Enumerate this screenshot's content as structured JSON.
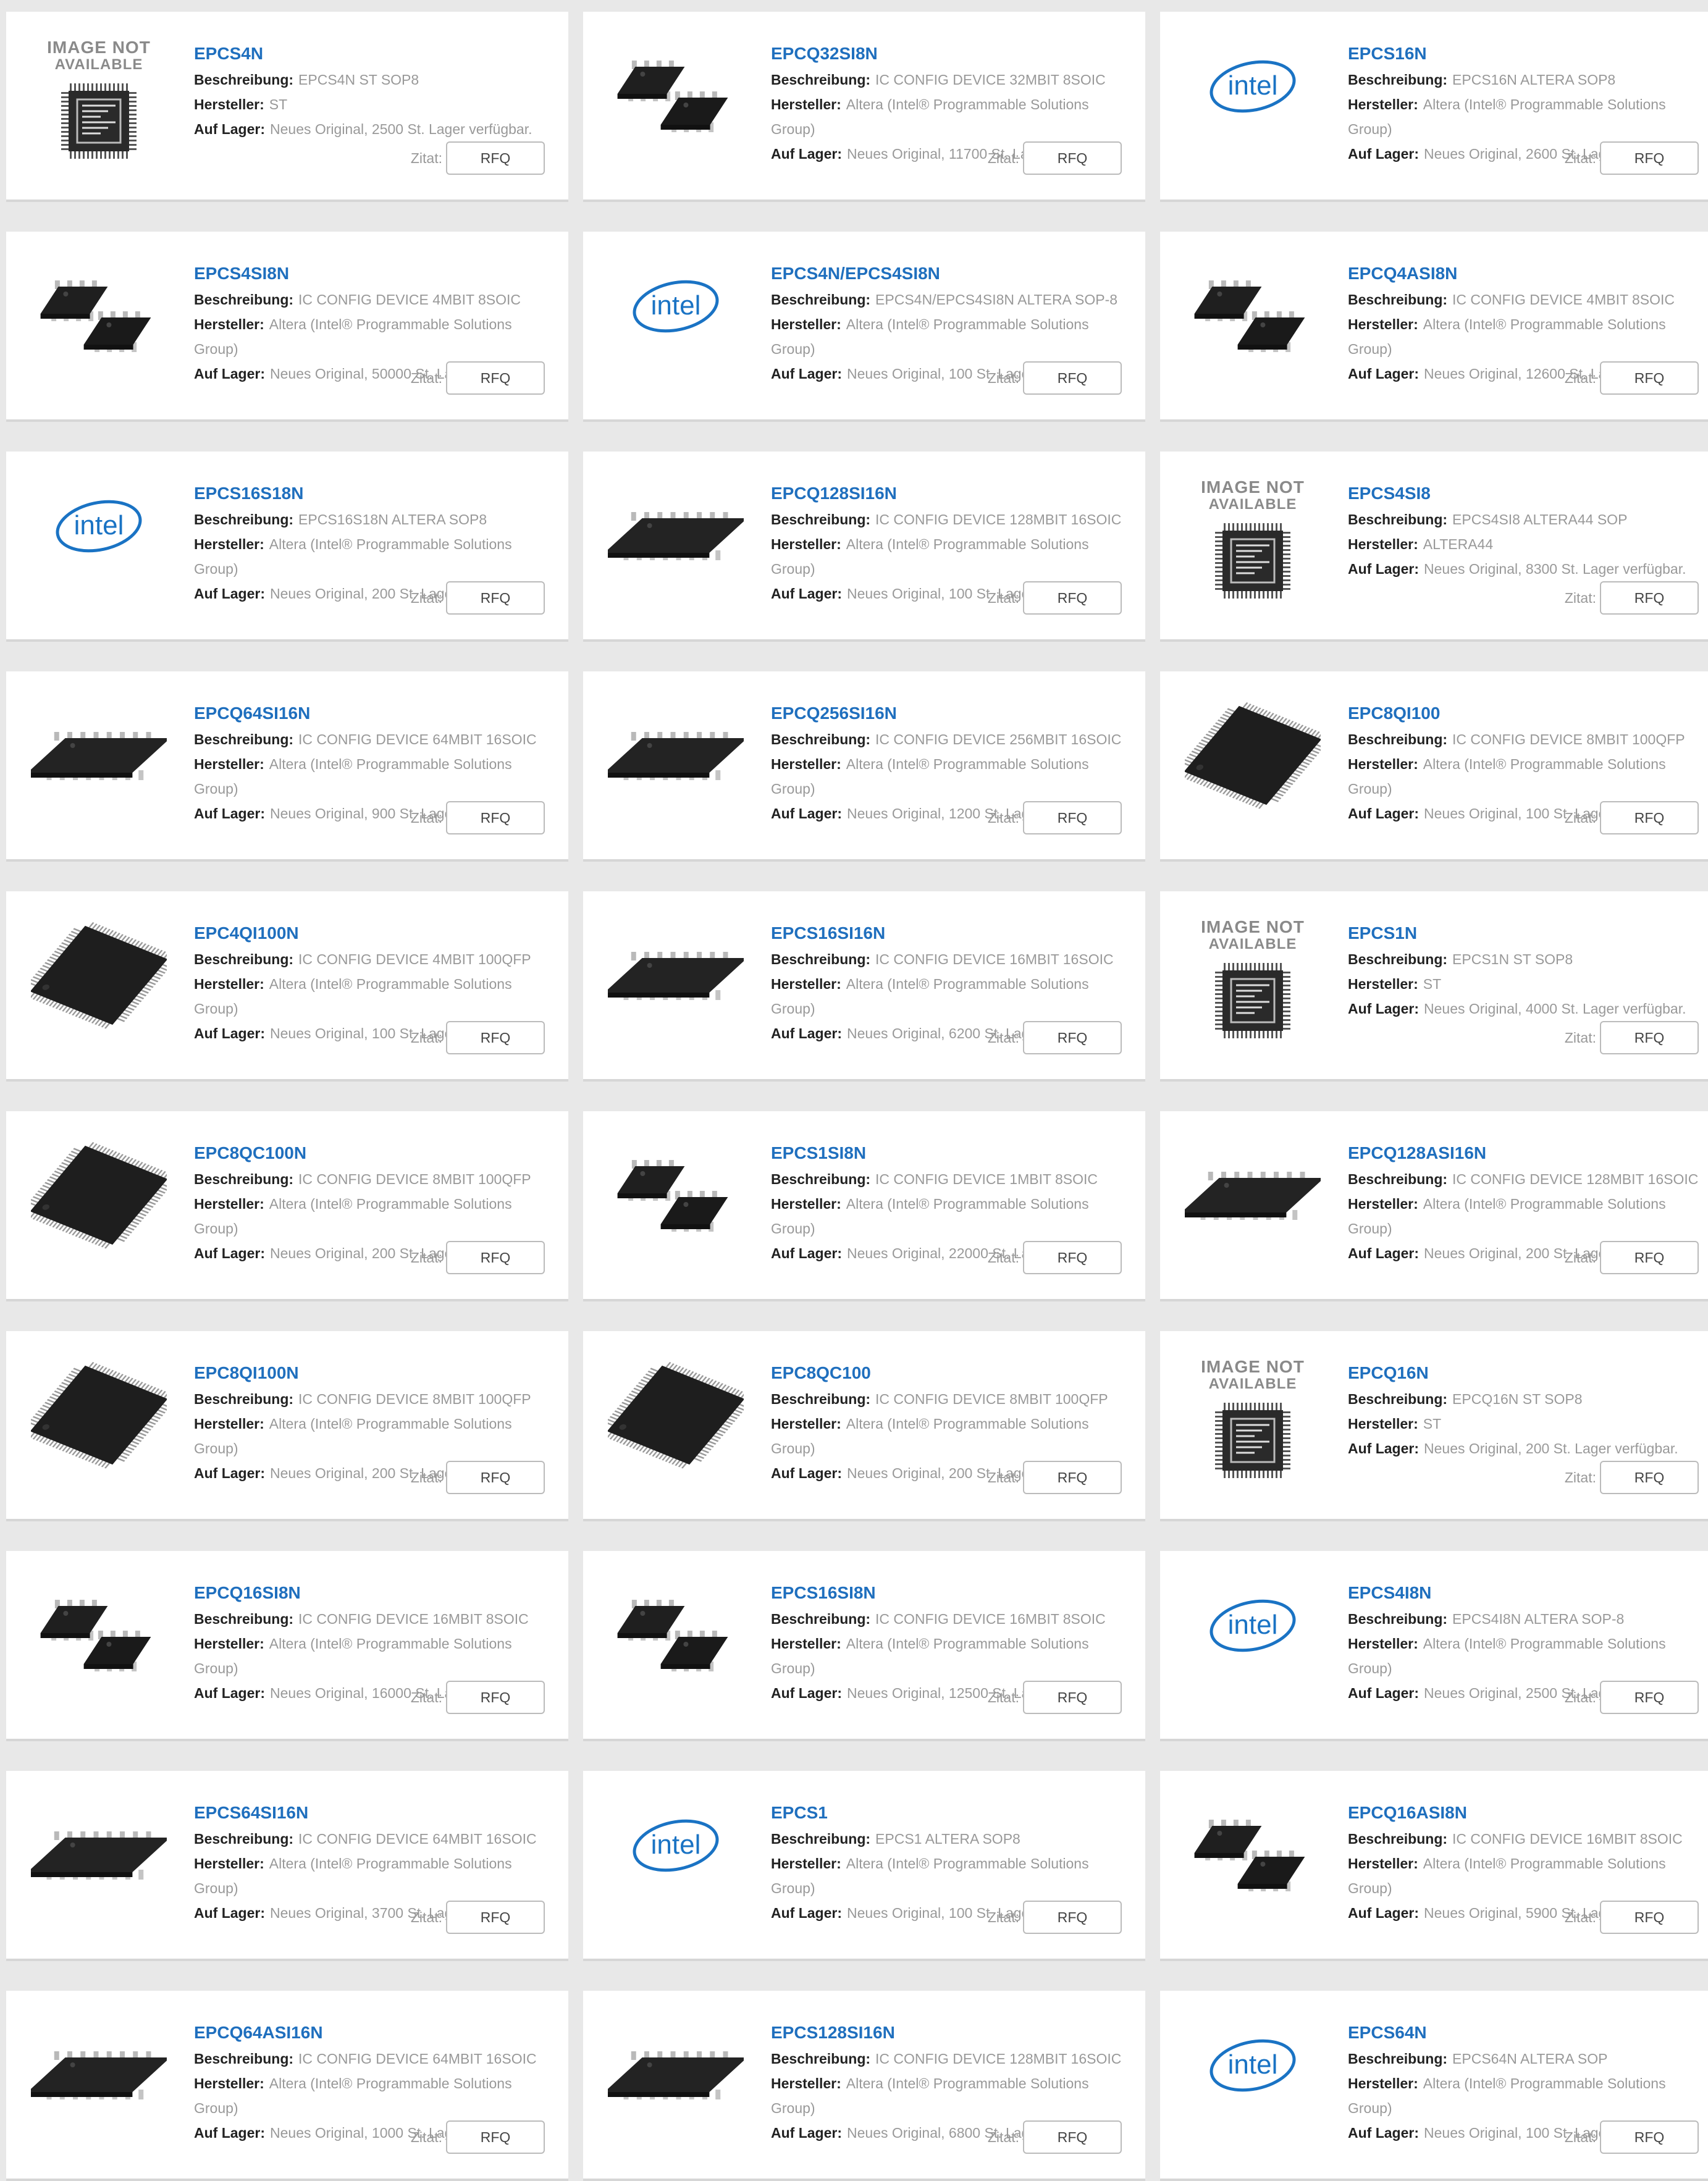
{
  "page": {
    "labels": {
      "description": "Beschreibung:",
      "manufacturer": "Hersteller:",
      "stock": "Auf Lager:",
      "quote": "Zitat:",
      "rfq": "RFQ"
    },
    "image_not_available": [
      "IMAGE NOT",
      "AVAILABLE"
    ],
    "intel_logo_text": "intel",
    "colors": {
      "page_background": "#e8e8e8",
      "card_background": "#ffffff",
      "product_link": "#1f6fbe",
      "intel_blue": "#1a73c4",
      "label": "#222222",
      "value": "#999999"
    },
    "image_kinds": [
      "no-image",
      "soic8",
      "soic16",
      "qfp100",
      "intel-logo"
    ]
  },
  "products": [
    {
      "name": "EPCS4N",
      "description": "EPCS4N ST SOP8",
      "manufacturer": "ST",
      "stock": "Neues Original, 2500 St. Lager verfügbar.",
      "image": "no-image"
    },
    {
      "name": "EPCQ32SI8N",
      "description": "IC CONFIG DEVICE 32MBIT 8SOIC",
      "manufacturer": "Altera (Intel® Programmable Solutions Group)",
      "stock": "Neues Original, 11700 St. Lager verfügbar.",
      "image": "soic8"
    },
    {
      "name": "EPCS16N",
      "description": "EPCS16N ALTERA SOP8",
      "manufacturer": "Altera (Intel® Programmable Solutions Group)",
      "stock": "Neues Original, 2600 St. Lager verfügbar.",
      "image": "intel-logo"
    },
    {
      "name": "EPCS4SI8N",
      "description": "IC CONFIG DEVICE 4MBIT 8SOIC",
      "manufacturer": "Altera (Intel® Programmable Solutions Group)",
      "stock": "Neues Original, 50000 St. Lager verfügbar.",
      "image": "soic8"
    },
    {
      "name": "EPCS4N/EPCS4SI8N",
      "description": "EPCS4N/EPCS4SI8N ALTERA SOP-8",
      "manufacturer": "Altera (Intel® Programmable Solutions Group)",
      "stock": "Neues Original, 100 St. Lager verfügbar.",
      "image": "intel-logo"
    },
    {
      "name": "EPCQ4ASI8N",
      "description": "IC CONFIG DEVICE 4MBIT 8SOIC",
      "manufacturer": "Altera (Intel® Programmable Solutions Group)",
      "stock": "Neues Original, 12600 St. Lager verfügbar.",
      "image": "soic8"
    },
    {
      "name": "EPCS16S18N",
      "description": "EPCS16S18N ALTERA SOP8",
      "manufacturer": "Altera (Intel® Programmable Solutions Group)",
      "stock": "Neues Original, 200 St. Lager verfügbar.",
      "image": "intel-logo"
    },
    {
      "name": "EPCQ128SI16N",
      "description": "IC CONFIG DEVICE 128MBIT 16SOIC",
      "manufacturer": "Altera (Intel® Programmable Solutions Group)",
      "stock": "Neues Original, 100 St. Lager verfügbar.",
      "image": "soic16"
    },
    {
      "name": "EPCS4SI8",
      "description": "EPCS4SI8 ALTERA44 SOP",
      "manufacturer": "ALTERA44",
      "stock": "Neues Original, 8300 St. Lager verfügbar.",
      "image": "no-image"
    },
    {
      "name": "EPCQ64SI16N",
      "description": "IC CONFIG DEVICE 64MBIT 16SOIC",
      "manufacturer": "Altera (Intel® Programmable Solutions Group)",
      "stock": "Neues Original, 900 St. Lager verfügbar.",
      "image": "soic16"
    },
    {
      "name": "EPCQ256SI16N",
      "description": "IC CONFIG DEVICE 256MBIT 16SOIC",
      "manufacturer": "Altera (Intel® Programmable Solutions Group)",
      "stock": "Neues Original, 1200 St. Lager verfügbar.",
      "image": "soic16"
    },
    {
      "name": "EPC8QI100",
      "description": "IC CONFIG DEVICE 8MBIT 100QFP",
      "manufacturer": "Altera (Intel® Programmable Solutions Group)",
      "stock": "Neues Original, 100 St. Lager verfügbar.",
      "image": "qfp100"
    },
    {
      "name": "EPC4QI100N",
      "description": "IC CONFIG DEVICE 4MBIT 100QFP",
      "manufacturer": "Altera (Intel® Programmable Solutions Group)",
      "stock": "Neues Original, 100 St. Lager verfügbar.",
      "image": "qfp100"
    },
    {
      "name": "EPCS16SI16N",
      "description": "IC CONFIG DEVICE 16MBIT 16SOIC",
      "manufacturer": "Altera (Intel® Programmable Solutions Group)",
      "stock": "Neues Original, 6200 St. Lager verfügbar.",
      "image": "soic16"
    },
    {
      "name": "EPCS1N",
      "description": "EPCS1N ST SOP8",
      "manufacturer": "ST",
      "stock": "Neues Original, 4000 St. Lager verfügbar.",
      "image": "no-image"
    },
    {
      "name": "EPC8QC100N",
      "description": "IC CONFIG DEVICE 8MBIT 100QFP",
      "manufacturer": "Altera (Intel® Programmable Solutions Group)",
      "stock": "Neues Original, 200 St. Lager verfügbar.",
      "image": "qfp100"
    },
    {
      "name": "EPCS1SI8N",
      "description": "IC CONFIG DEVICE 1MBIT 8SOIC",
      "manufacturer": "Altera (Intel® Programmable Solutions Group)",
      "stock": "Neues Original, 22000 St. Lager verfügbar.",
      "image": "soic8"
    },
    {
      "name": "EPCQ128ASI16N",
      "description": "IC CONFIG DEVICE 128MBIT 16SOIC",
      "manufacturer": "Altera (Intel® Programmable Solutions Group)",
      "stock": "Neues Original, 200 St. Lager verfügbar.",
      "image": "soic16"
    },
    {
      "name": "EPC8QI100N",
      "description": "IC CONFIG DEVICE 8MBIT 100QFP",
      "manufacturer": "Altera (Intel® Programmable Solutions Group)",
      "stock": "Neues Original, 200 St. Lager verfügbar.",
      "image": "qfp100"
    },
    {
      "name": "EPC8QC100",
      "description": "IC CONFIG DEVICE 8MBIT 100QFP",
      "manufacturer": "Altera (Intel® Programmable Solutions Group)",
      "stock": "Neues Original, 200 St. Lager verfügbar.",
      "image": "qfp100"
    },
    {
      "name": "EPCQ16N",
      "description": "EPCQ16N ST SOP8",
      "manufacturer": "ST",
      "stock": "Neues Original, 200 St. Lager verfügbar.",
      "image": "no-image"
    },
    {
      "name": "EPCQ16SI8N",
      "description": "IC CONFIG DEVICE 16MBIT 8SOIC",
      "manufacturer": "Altera (Intel® Programmable Solutions Group)",
      "stock": "Neues Original, 16000 St. Lager verfügbar.",
      "image": "soic8"
    },
    {
      "name": "EPCS16SI8N",
      "description": "IC CONFIG DEVICE 16MBIT 8SOIC",
      "manufacturer": "Altera (Intel® Programmable Solutions Group)",
      "stock": "Neues Original, 12500 St. Lager verfügbar.",
      "image": "soic8"
    },
    {
      "name": "EPCS4I8N",
      "description": "EPCS4I8N   ALTERA SOP-8",
      "manufacturer": "Altera (Intel® Programmable Solutions Group)",
      "stock": "Neues Original, 2500 St. Lager verfügbar.",
      "image": "intel-logo"
    },
    {
      "name": "EPCS64SI16N",
      "description": "IC CONFIG DEVICE 64MBIT 16SOIC",
      "manufacturer": "Altera (Intel® Programmable Solutions Group)",
      "stock": "Neues Original, 3700 St. Lager verfügbar.",
      "image": "soic16"
    },
    {
      "name": "EPCS1",
      "description": "EPCS1 ALTERA   SOP8",
      "manufacturer": "Altera (Intel® Programmable Solutions Group)",
      "stock": "Neues Original, 100 St. Lager verfügbar.",
      "image": "intel-logo"
    },
    {
      "name": "EPCQ16ASI8N",
      "description": "IC CONFIG DEVICE 16MBIT 8SOIC",
      "manufacturer": "Altera (Intel® Programmable Solutions Group)",
      "stock": "Neues Original, 5900 St. Lager verfügbar.",
      "image": "soic8"
    },
    {
      "name": "EPCQ64ASI16N",
      "description": "IC CONFIG DEVICE 64MBIT 16SOIC",
      "manufacturer": "Altera (Intel® Programmable Solutions Group)",
      "stock": "Neues Original, 1000 St. Lager verfügbar.",
      "image": "soic16"
    },
    {
      "name": "EPCS128SI16N",
      "description": "IC CONFIG DEVICE 128MBIT 16SOIC",
      "manufacturer": "Altera (Intel® Programmable Solutions Group)",
      "stock": "Neues Original, 6800 St. Lager verfügbar.",
      "image": "soic16"
    },
    {
      "name": "EPCS64N",
      "description": "EPCS64N ALTERA SOP",
      "manufacturer": "Altera (Intel® Programmable Solutions Group)",
      "stock": "Neues Original, 100 St. Lager verfügbar.",
      "image": "intel-logo"
    }
  ]
}
